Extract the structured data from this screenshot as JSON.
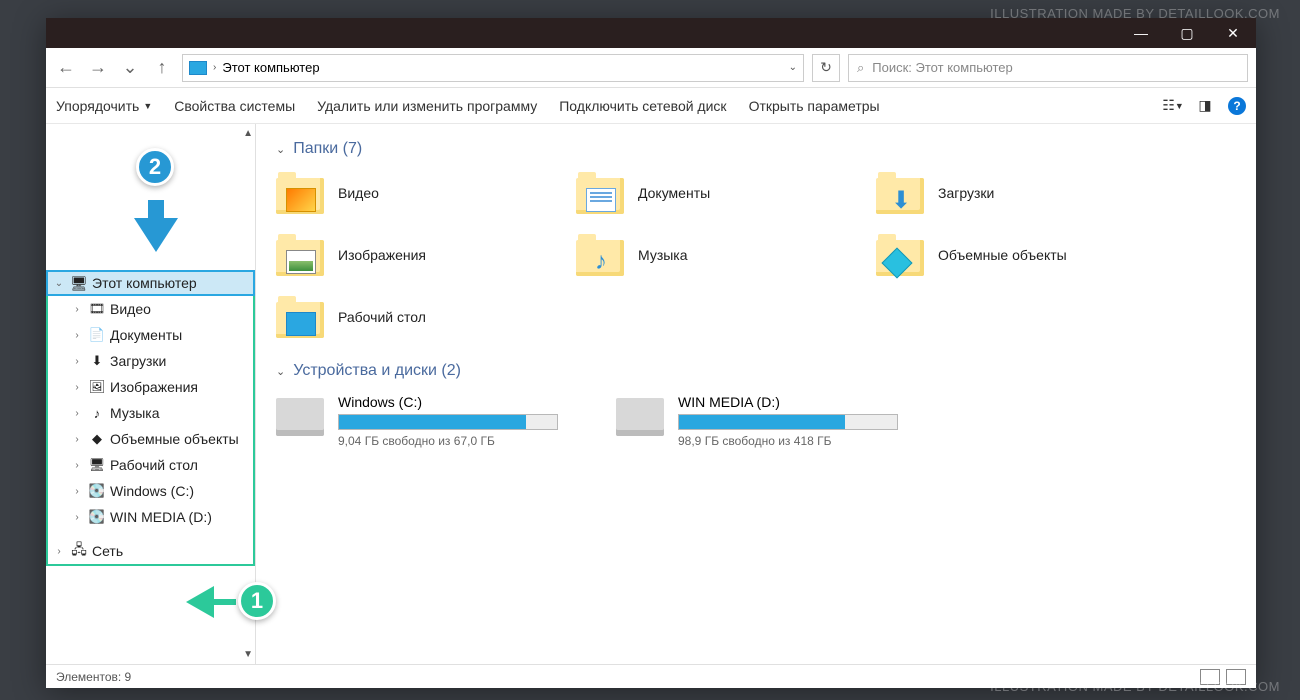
{
  "watermark": "ILLUSTRATION MADE BY DETAILLOOK.COM",
  "titlebar": {
    "min": "—",
    "max": "▢",
    "close": "✕"
  },
  "nav": {
    "back": "←",
    "forward": "→",
    "up": "↑",
    "separator": "›",
    "location": "Этот компьютер",
    "dropdown": "⌄",
    "refresh": "↻"
  },
  "search": {
    "icon": "⌕",
    "placeholder": "Поиск: Этот компьютер"
  },
  "toolbar": {
    "organize": "Упорядочить",
    "properties": "Свойства системы",
    "uninstall": "Удалить или изменить программу",
    "mapdrive": "Подключить сетевой диск",
    "settings": "Открыть параметры",
    "help": "?"
  },
  "sidebar": {
    "this_pc": "Этот компьютер",
    "items": [
      {
        "label": "Видео",
        "icon": "🎞"
      },
      {
        "label": "Документы",
        "icon": "📄"
      },
      {
        "label": "Загрузки",
        "icon": "⬇"
      },
      {
        "label": "Изображения",
        "icon": "🖼"
      },
      {
        "label": "Музыка",
        "icon": "♪"
      },
      {
        "label": "Объемные объекты",
        "icon": "◆"
      },
      {
        "label": "Рабочий стол",
        "icon": "🖥"
      },
      {
        "label": "Windows (C:)",
        "icon": "💽"
      },
      {
        "label": "WIN MEDIA (D:)",
        "icon": "💽"
      }
    ],
    "network": "Сеть"
  },
  "content": {
    "folders_header": "Папки (7)",
    "folders": [
      {
        "label": "Видео",
        "ov": "ov-video"
      },
      {
        "label": "Документы",
        "ov": "ov-doc"
      },
      {
        "label": "Загрузки",
        "ov": "ov-down",
        "glyph": "⬇"
      },
      {
        "label": "Изображения",
        "ov": "ov-img"
      },
      {
        "label": "Музыка",
        "ov": "ov-music",
        "glyph": "♪"
      },
      {
        "label": "Объемные объекты",
        "ov": "ov-3d"
      },
      {
        "label": "Рабочий стол",
        "ov": "ov-desktop"
      }
    ],
    "drives_header": "Устройства и диски (2)",
    "drives": [
      {
        "name": "Windows (C:)",
        "stats": "9,04 ГБ свободно из 67,0 ГБ",
        "fill": 86
      },
      {
        "name": "WIN MEDIA (D:)",
        "stats": "98,9 ГБ свободно из 418 ГБ",
        "fill": 76
      }
    ]
  },
  "statusbar": {
    "count": "Элементов: 9"
  },
  "annotations": {
    "one": "1",
    "two": "2"
  }
}
